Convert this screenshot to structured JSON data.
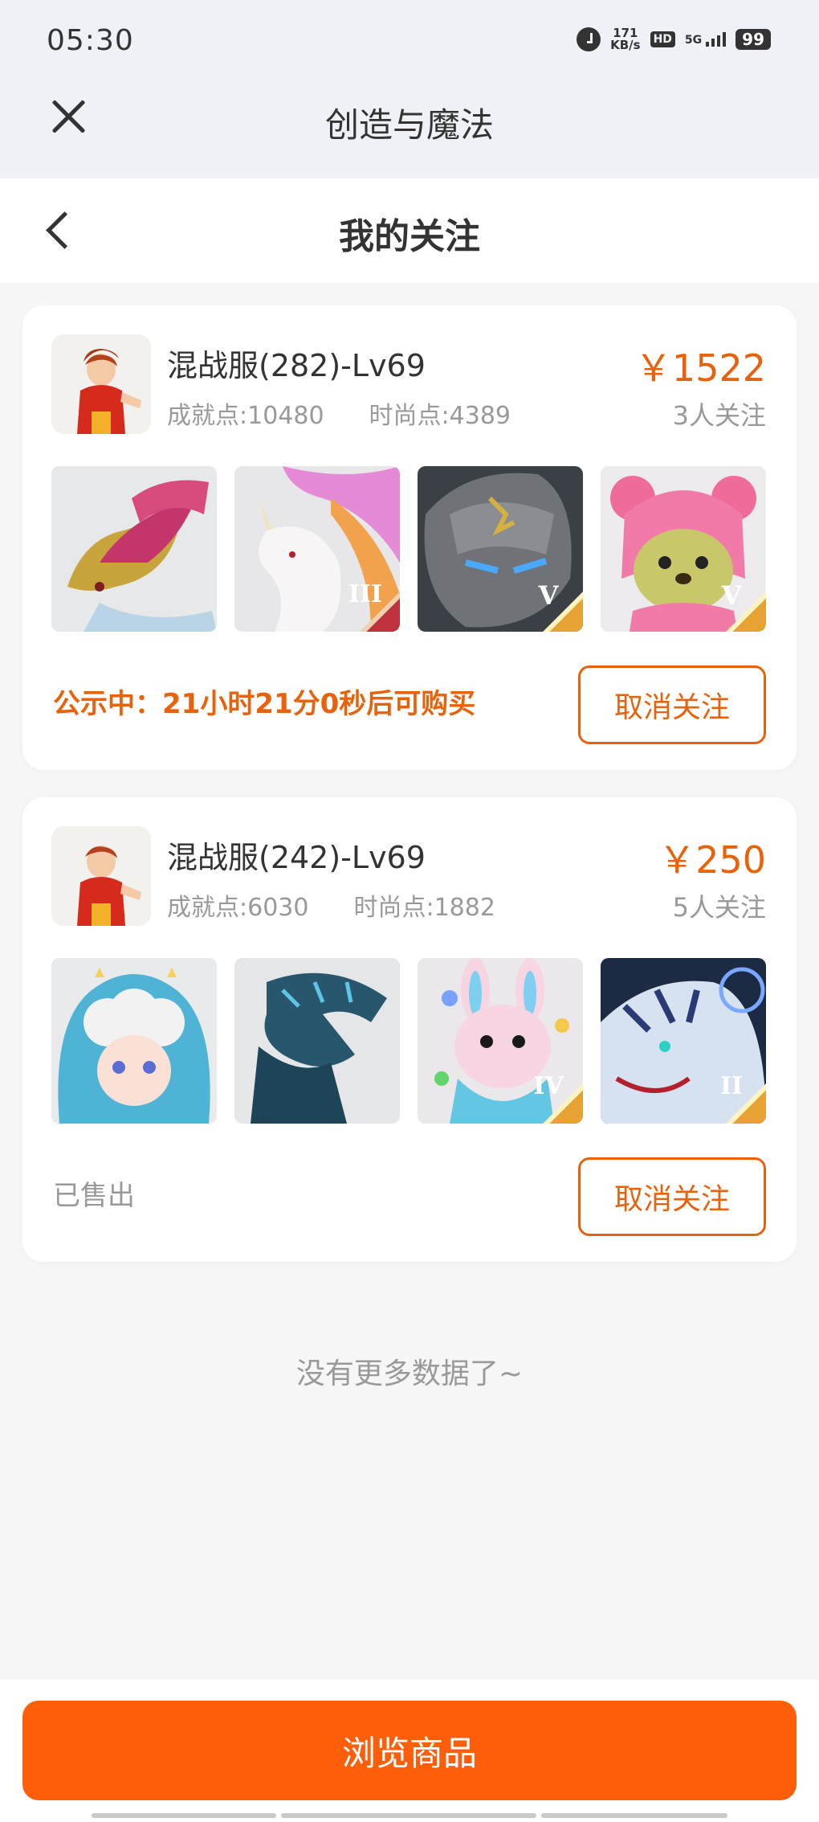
{
  "status_bar": {
    "time": "05:30",
    "speed_value": "171",
    "speed_unit": "KB/s",
    "hd": "HD",
    "network": "5G",
    "battery": "99"
  },
  "app_bar": {
    "title": "创造与魔法"
  },
  "nav": {
    "title": "我的关注"
  },
  "cards": [
    {
      "server": "混战服(282)-Lv69",
      "achievement": "成就点:10480",
      "fashion": "时尚点:4389",
      "price": "￥1522",
      "followers": "3人关注",
      "status": "公示中：21小时21分0秒后可购买",
      "button": "取消关注",
      "badges": [
        "",
        "III",
        "V",
        "V"
      ]
    },
    {
      "server": "混战服(242)-Lv69",
      "achievement": "成就点:6030",
      "fashion": "时尚点:1882",
      "price": "￥250",
      "followers": "5人关注",
      "status": "已售出",
      "button": "取消关注",
      "badges": [
        "",
        "",
        "IV",
        "II"
      ]
    }
  ],
  "footer_note": "没有更多数据了~",
  "bottom_button": "浏览商品",
  "colors": {
    "accent": "#e8620c",
    "button": "#fe5d0a"
  }
}
